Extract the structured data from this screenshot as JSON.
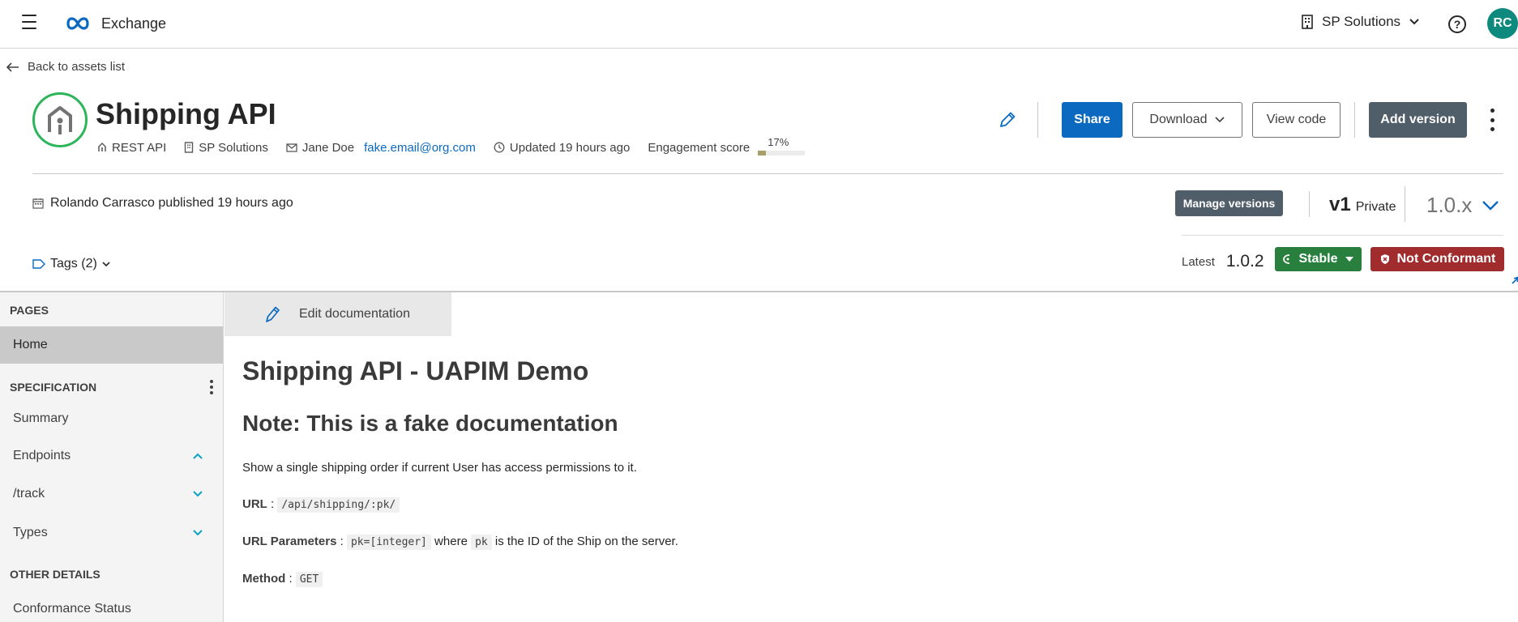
{
  "topbar": {
    "app_name": "Exchange",
    "org_name": "SP Solutions",
    "avatar_initials": "RC",
    "brand_color": "#0b6ac0",
    "avatar_color": "#0d8a7d"
  },
  "nav": {
    "back_label": "Back to assets list"
  },
  "asset": {
    "title": "Shipping API",
    "type": "REST API",
    "org": "SP Solutions",
    "contact_name": "Jane Doe",
    "contact_email": "fake.email@org.com",
    "updated": "Updated 19 hours ago",
    "engagement_label": "Engagement score",
    "engagement_score": "17%",
    "engagement_fraction": 0.17
  },
  "actions": {
    "share": "Share",
    "download": "Download",
    "view_code": "View code",
    "add_version": "Add version",
    "manage_versions": "Manage versions"
  },
  "version": {
    "published": "Rolando Carrasco published 19 hours ago",
    "major": "v1",
    "visibility": "Private",
    "selected": "1.0.x",
    "latest_label": "Latest",
    "latest_value": "1.0.2",
    "lifecycle": "Stable",
    "conformance": "Not Conformant"
  },
  "tags": {
    "label": "Tags (2)"
  },
  "sidebar": {
    "pages_header": "PAGES",
    "pages": [
      {
        "label": "Home"
      }
    ],
    "spec_header": "SPECIFICATION",
    "spec_items": [
      {
        "label": "Summary"
      },
      {
        "label": "Endpoints"
      },
      {
        "label": "/track"
      },
      {
        "label": "Types"
      }
    ],
    "other_header": "OTHER DETAILS",
    "other_items": [
      {
        "label": "Conformance Status"
      }
    ]
  },
  "doc": {
    "edit_label": "Edit documentation",
    "h1": "Shipping API - UAPIM Demo",
    "h2": "Note: This is a fake documentation",
    "intro": "Show a single shipping order if current User has access permissions to it.",
    "url_label": "URL",
    "url_sep": " : ",
    "url_value": "/api/shipping/:pk/",
    "params_label": "URL Parameters",
    "params_sep": " : ",
    "params_code": "pk=[integer]",
    "params_where": " where ",
    "params_pk": "pk",
    "params_rest": " is the ID of the Ship on the server.",
    "method_label": "Method",
    "method_sep": " : ",
    "method_value": "GET"
  }
}
